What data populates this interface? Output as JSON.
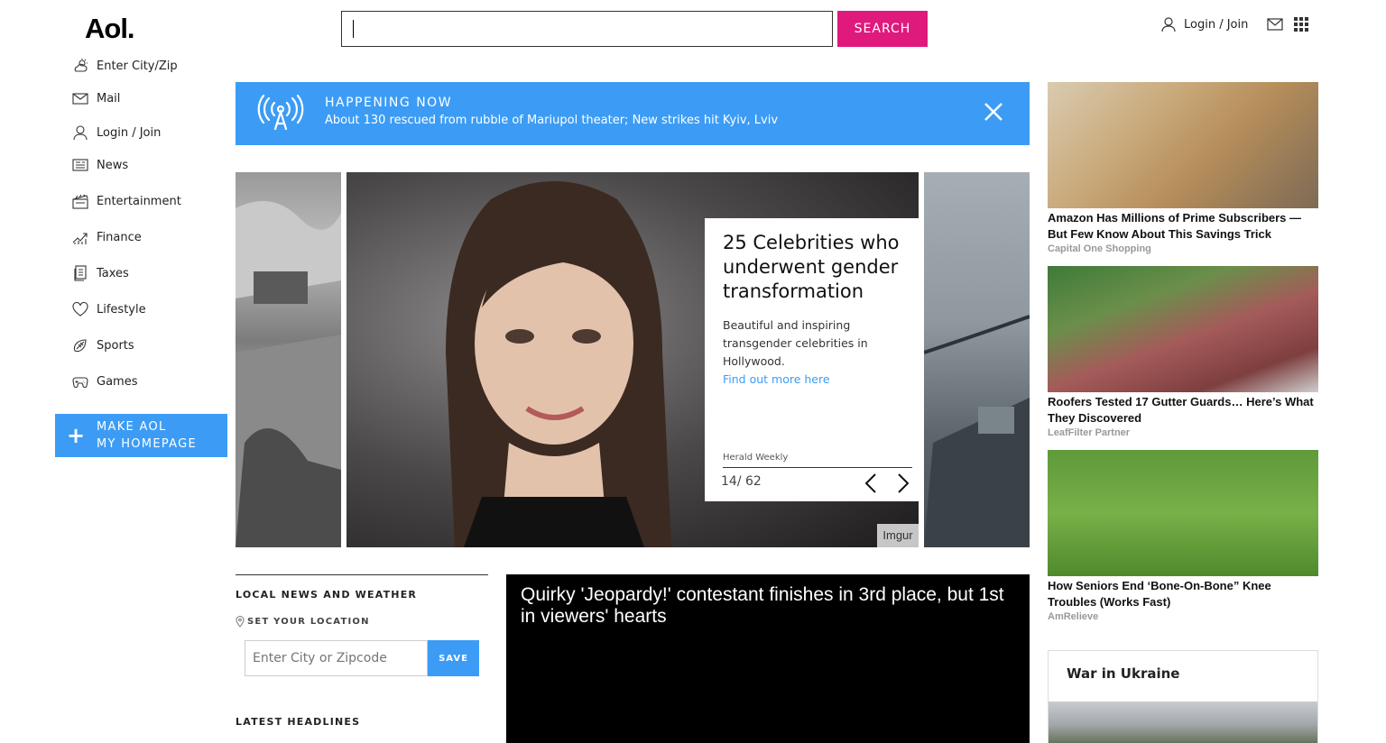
{
  "header": {
    "logo": "Aol.",
    "search_value": "",
    "search_button": "SEARCH",
    "login": "Login / Join"
  },
  "nav": {
    "items": [
      {
        "label": "Enter City/Zip",
        "icon": "weather-icon"
      },
      {
        "label": "Mail",
        "icon": "mail-icon"
      },
      {
        "label": "Login / Join",
        "icon": "user-icon"
      },
      {
        "label": "News",
        "icon": "news-icon"
      },
      {
        "label": "Entertainment",
        "icon": "clapperboard-icon"
      },
      {
        "label": "Finance",
        "icon": "chart-icon"
      },
      {
        "label": "Taxes",
        "icon": "document-icon"
      },
      {
        "label": "Lifestyle",
        "icon": "heart-icon"
      },
      {
        "label": "Sports",
        "icon": "football-icon"
      },
      {
        "label": "Games",
        "icon": "gamepad-icon"
      }
    ],
    "homepage_line1": "MAKE AOL",
    "homepage_line2": "MY HOMEPAGE"
  },
  "happening": {
    "label": "HAPPENING NOW",
    "text": "About 130 rescued from rubble of Mariupol theater; New strikes hit Kyiv, Lviv"
  },
  "slideshow": {
    "title": "25 Celebrities who underwent gender transformation",
    "description": "Beautiful and inspiring transgender celebrities in Hollywood.",
    "link": "Find out more here",
    "source": "Herald Weekly",
    "counter": "14/ 62",
    "credit": "Imgur"
  },
  "local": {
    "heading": "LOCAL NEWS AND WEATHER",
    "set_location": "SET YOUR LOCATION",
    "zip_placeholder": "Enter City or Zipcode",
    "save": "SAVE",
    "latest": "LATEST HEADLINES"
  },
  "video": {
    "title": "Quirky 'Jeopardy!' contestant finishes in 3rd place, but 1st in viewers' hearts"
  },
  "ads": [
    {
      "title": "Amazon Has Millions of Prime Subscribers — But Few Know About This Savings Trick",
      "source": "Capital One Shopping"
    },
    {
      "title": "Roofers Tested 17 Gutter Guards… Here’s What They Discovered",
      "source": "LeafFilter Partner"
    },
    {
      "title": "How Seniors End ‘Bone-On-Bone” Knee Troubles (Works Fast)",
      "source": "AmRelieve"
    }
  ],
  "ukraine": {
    "title": "War in Ukraine"
  },
  "colors": {
    "brand_pink": "#e0197d",
    "accent_blue": "#3c9cf5"
  }
}
